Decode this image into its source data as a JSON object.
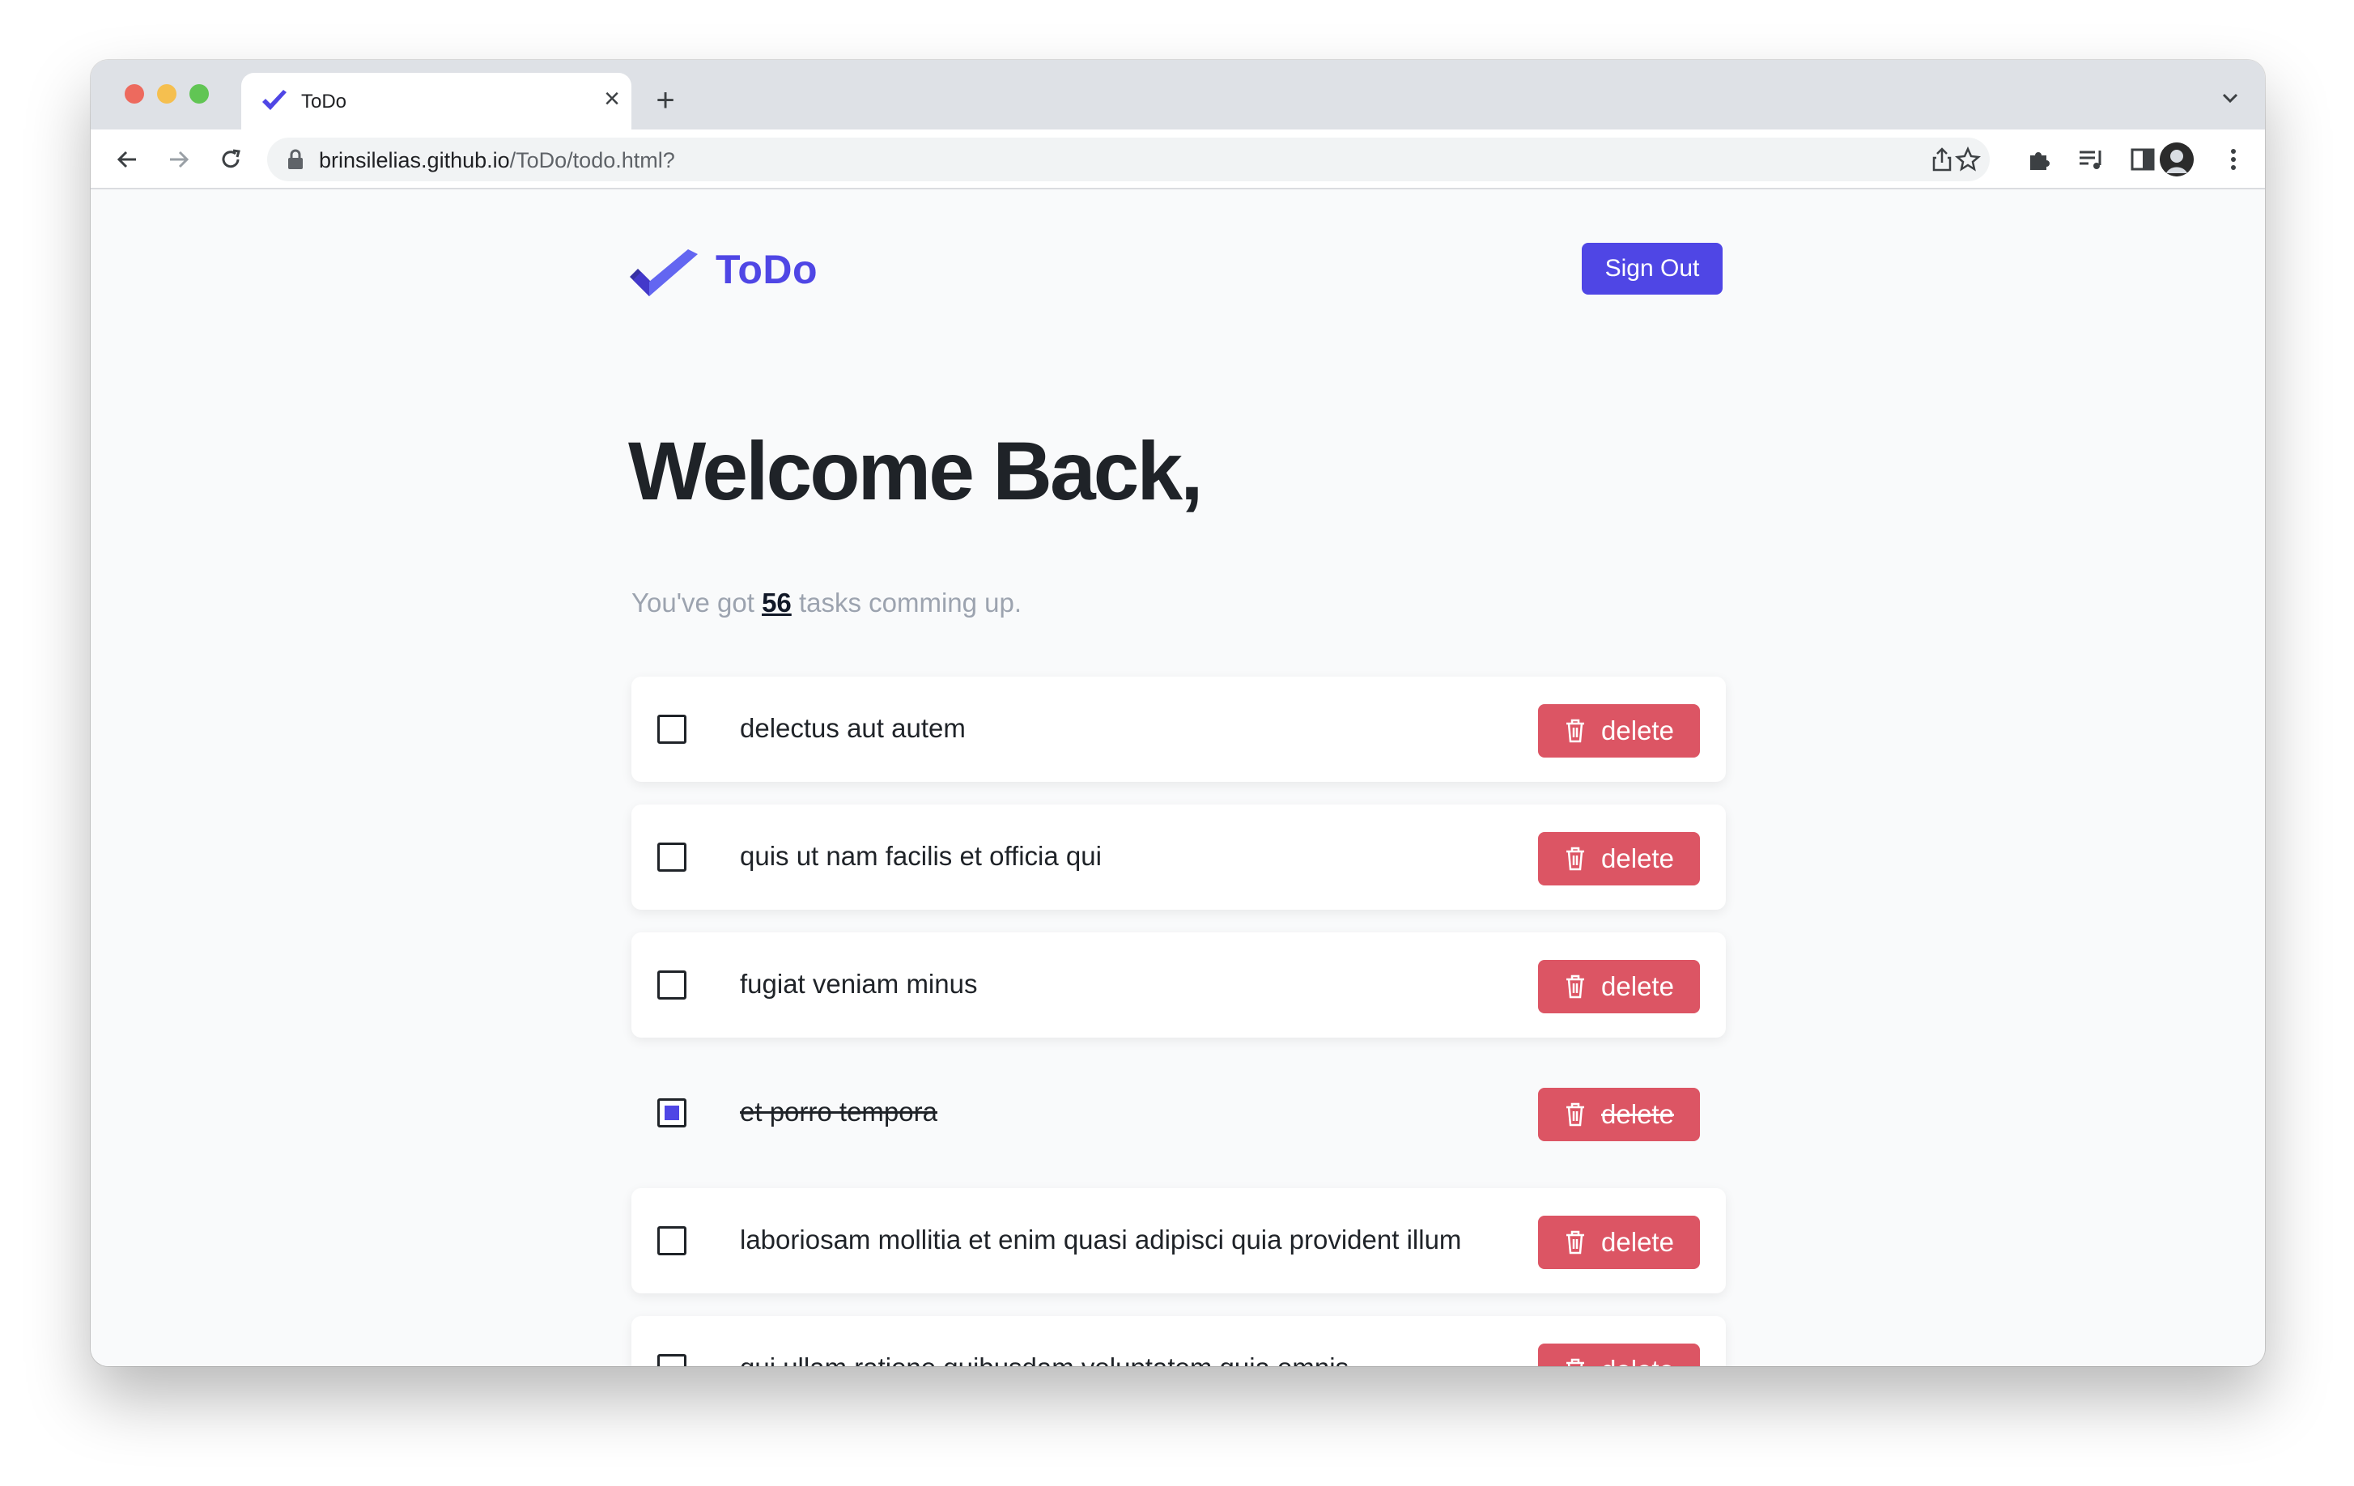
{
  "browser": {
    "tab": {
      "title": "ToDo",
      "close_glyph": "×"
    },
    "new_tab_glyph": "+",
    "url_host": "brinsilelias.github.io",
    "url_path": "/ToDo/todo.html?"
  },
  "header": {
    "brand": "ToDo",
    "sign_out_label": "Sign Out"
  },
  "hero": {
    "title": "Welcome Back,",
    "subtitle_prefix": "You've got ",
    "task_count": "56",
    "subtitle_suffix": " tasks comming up."
  },
  "tasks": [
    {
      "text": "delectus aut autem",
      "completed": false,
      "delete_label": "delete"
    },
    {
      "text": "quis ut nam facilis et officia qui",
      "completed": false,
      "delete_label": "delete"
    },
    {
      "text": "fugiat veniam minus",
      "completed": false,
      "delete_label": "delete"
    },
    {
      "text": "et porro tempora",
      "completed": true,
      "delete_label": "delete"
    },
    {
      "text": "laboriosam mollitia et enim quasi adipisci quia provident illum",
      "completed": false,
      "delete_label": "delete"
    },
    {
      "text": "qui ullam ratione quibusdam voluptatem quia omnis",
      "completed": false,
      "delete_label": "delete"
    }
  ],
  "colors": {
    "accent": "#4f46e5",
    "danger": "#dc5564",
    "page_bg": "#f9fafb"
  }
}
